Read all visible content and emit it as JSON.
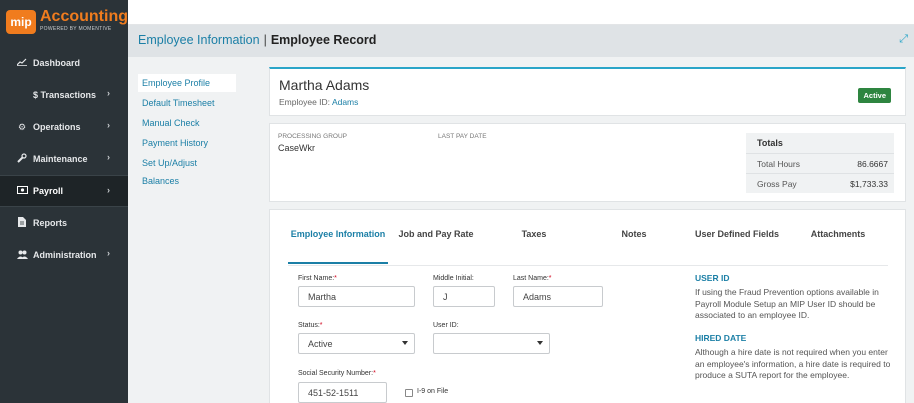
{
  "app": {
    "logo_badge": "mip",
    "logo_title": "Accounting",
    "logo_sub": "POWERED BY MOMENTIVE"
  },
  "sidebar": {
    "items": [
      {
        "label": "Dashboard",
        "icon": "chart-line-icon"
      },
      {
        "label": "$ Transactions",
        "icon": "dollar-icon"
      },
      {
        "label": "Operations",
        "icon": "cogs-icon"
      },
      {
        "label": "Maintenance",
        "icon": "wrench-icon"
      },
      {
        "label": "Payroll",
        "icon": "money-bill-icon"
      },
      {
        "label": "Reports",
        "icon": "file-icon"
      },
      {
        "label": "Administration",
        "icon": "users-icon"
      }
    ],
    "chevron": "›"
  },
  "header": {
    "breadcrumb_link": "Employee Information",
    "separator": "|",
    "current": "Employee Record",
    "expand_glyph": "⤢"
  },
  "subnav": {
    "items": [
      "Employee Profile",
      "Default Timesheet",
      "Manual Check",
      "Payment History",
      "Set Up/Adjust Balances"
    ]
  },
  "employee": {
    "name": "Martha Adams",
    "id_label": "Employee ID:",
    "id_value": "Adams",
    "status_badge": "Active"
  },
  "summary": {
    "processing_group_label": "PROCESSING GROUP",
    "processing_group_value": "CaseWkr",
    "last_pay_date_label": "LAST PAY DATE",
    "totals_title": "Totals",
    "total_hours_label": "Total Hours",
    "total_hours_value": "86.6667",
    "gross_pay_label": "Gross Pay",
    "gross_pay_value": "$1,733.33"
  },
  "tabs": [
    {
      "label": "Employee Information"
    },
    {
      "label": "Job and Pay Rate"
    },
    {
      "label": "Taxes"
    },
    {
      "label": "Notes"
    },
    {
      "label": "User Defined Fields"
    },
    {
      "label": "Attachments"
    }
  ],
  "form": {
    "first_name_label": "First Name:",
    "first_name_value": "Martha",
    "middle_initial_label": "Middle Initial:",
    "middle_initial_value": "J",
    "last_name_label": "Last Name:",
    "last_name_value": "Adams",
    "status_label": "Status:",
    "status_value": "Active",
    "user_id_label": "User ID:",
    "user_id_value": "",
    "ssn_label": "Social Security Number:",
    "ssn_value": "451-52-1511",
    "i9_label": "I-9 on File",
    "required_mark": "*"
  },
  "help": {
    "user_id_title": "USER ID",
    "user_id_text": "If using the Fraud Prevention options available in Payroll Module Setup an MIP User ID should be associated to an employee ID.",
    "hired_date_title": "HIRED DATE",
    "hired_date_text": "Although a hire date is not required when you enter an employee's information, a hire date is required to produce a SUTA report for the employee."
  },
  "colors": {
    "sidebar_bg": "#2b3338",
    "brand_orange": "#f07c1e",
    "link_blue": "#1b7fa6",
    "active_green": "#2e8540",
    "required_red": "#d0021b"
  }
}
